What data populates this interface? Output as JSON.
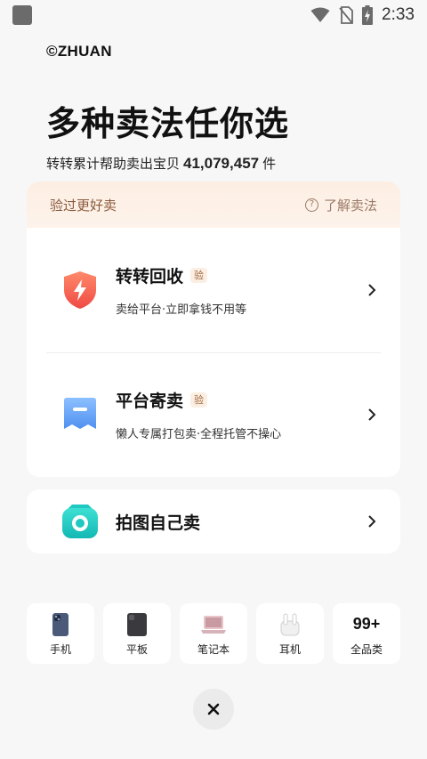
{
  "status_bar": {
    "time": "2:33",
    "icons": [
      "app-notification-icon",
      "wifi-icon",
      "no-sim-icon",
      "battery-charging-icon"
    ]
  },
  "brand": "©ZHUAN",
  "headline": "多种卖法任你选",
  "subline": {
    "prefix": "转转累计帮助卖出宝贝",
    "count": "41,079,457",
    "suffix": "件"
  },
  "card": {
    "header_title": "验过更好卖",
    "learn_label": "了解卖法",
    "learn_icon": "question-circle-icon",
    "options": [
      {
        "title": "转转回收",
        "badge": "验",
        "desc": "卖给平台·立即拿钱不用等",
        "icon": "shield-bolt-icon"
      },
      {
        "title": "平台寄卖",
        "badge": "验",
        "desc": "懒人专属打包卖·全程托管不操心",
        "icon": "consign-card-icon"
      }
    ]
  },
  "self_sell": {
    "title": "拍图自己卖",
    "icon": "camera-icon"
  },
  "categories": [
    {
      "label": "手机",
      "icon": "phone-icon"
    },
    {
      "label": "平板",
      "icon": "tablet-icon"
    },
    {
      "label": "笔记本",
      "icon": "laptop-icon"
    },
    {
      "label": "耳机",
      "icon": "earbuds-icon"
    },
    {
      "label": "全品类",
      "count": "99+"
    }
  ],
  "colors": {
    "accent_brown": "#8a5a3c",
    "header_bg": "#fdeee3",
    "shield_red": "#f05a4a",
    "consign_blue": "#5b9cf0",
    "camera_teal": "#1fc8c0"
  }
}
